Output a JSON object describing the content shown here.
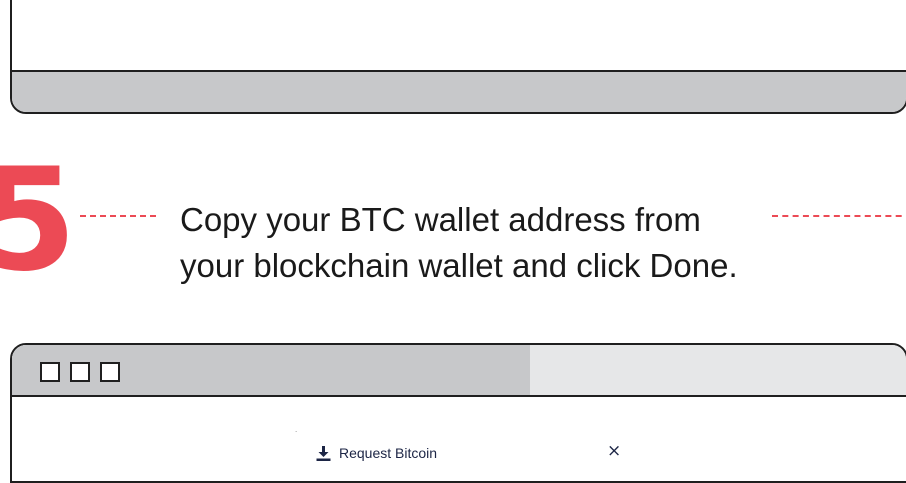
{
  "step": {
    "number": "5",
    "instruction_line1": "Copy your BTC wallet address from",
    "instruction_line2": "your blockchain wallet and click Done."
  },
  "dialog": {
    "title": "Request Bitcoin",
    "close_symbol": "×",
    "tiny_mark": "·",
    "icons": [
      "download-icon",
      "close-icon"
    ]
  },
  "colors": {
    "accent": "#ec4a55",
    "frame": "#1f1f1f",
    "bar_gray": "#c7c8ca",
    "title_light": "#e6e7e8",
    "dialog_text": "#1c2545"
  }
}
